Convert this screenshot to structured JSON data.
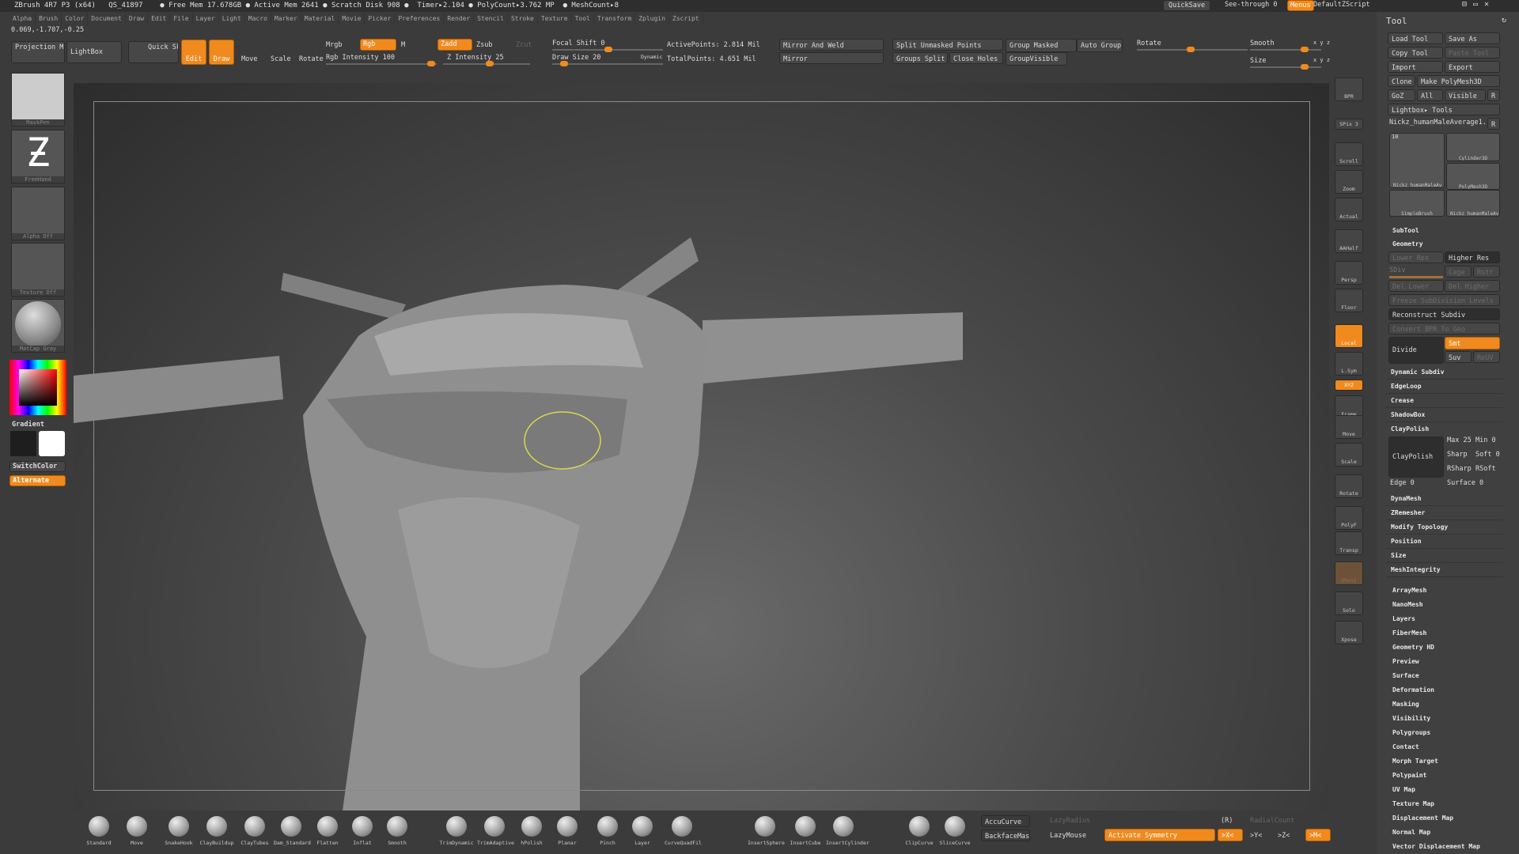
{
  "titlebar": {
    "text": "ZBrush 4R7 P3 (x64)   QS_41897    ● Free Mem 17.678GB ● Active Mem 2641 ● Scratch Disk 908 ●  Timer▸2.104 ● PolyCount▸3.762 MP  ● MeshCount▸8",
    "quicksave": "QuickSave",
    "see_through": "See-through  0",
    "menus": "Menus",
    "default_zscript": "DefaultZScript"
  },
  "menus": [
    "Alpha",
    "Brush",
    "Color",
    "Document",
    "Draw",
    "Edit",
    "File",
    "Layer",
    "Light",
    "Macro",
    "Marker",
    "Material",
    "Movie",
    "Picker",
    "Preferences",
    "Render",
    "Stencil",
    "Stroke",
    "Texture",
    "Tool",
    "Transform",
    "Zplugin",
    "Zscript"
  ],
  "coords": "0.069,-1.707,-0.25",
  "toolbar": {
    "projection_master": "Projection Master",
    "lightbox": "LightBox",
    "quick_sketch": "Quick Sketch",
    "edit": "Edit",
    "draw": "Draw",
    "move": "Move",
    "scale": "Scale",
    "rotate": "Rotate",
    "mrgb": "Mrgb",
    "rgb": "Rgb",
    "m": "M",
    "rgb_intensity": "Rgb Intensity 100",
    "zadd": "Zadd",
    "zsub": "Zsub",
    "zcut": "Zcut",
    "z_intensity": "Z Intensity 25",
    "focal_shift": "Focal Shift 0",
    "draw_size": "Draw Size 20",
    "dynamic": "Dynamic",
    "active_points": "ActivePoints: 2.814 Mil",
    "total_points": "TotalPoints: 4.651 Mil",
    "mirror_and_weld": "Mirror And Weld",
    "mirror": "Mirror",
    "split_unmasked": "Split Unmasked Points",
    "groups_split": "Groups Split",
    "close_holes": "Close Holes",
    "group_masked": "Group Masked",
    "auto_groups": "Auto Groups",
    "group_visible": "GroupVisible",
    "rotate_label": "Rotate",
    "smooth": "Smooth",
    "size": "Size",
    "xyz": "x y z"
  },
  "left_shelf": {
    "brush": "MaskPen",
    "stroke": "FreeHand",
    "alpha": "Alpha Off",
    "texture": "Texture Off",
    "material": "MatCap Gray",
    "gradient": "Gradient",
    "switch_color": "SwitchColor",
    "alternate": "Alternate"
  },
  "right_toolbar": [
    "BPR",
    "SPix 3",
    "Scroll",
    "Zoom",
    "Actual",
    "AAHalf",
    "Persp",
    "Floor",
    "Local",
    "L.Sym",
    "XYZ",
    "Frame",
    "Move",
    "Scale",
    "Rotate",
    "PolyF",
    "Transp",
    "Ghost",
    "Solo",
    "Xpose"
  ],
  "tool_panel": {
    "title": "Tool",
    "load_tool": "Load Tool",
    "save_as": "Save As",
    "copy_tool": "Copy Tool",
    "paste_tool": "Paste Tool",
    "import": "Import",
    "export": "Export",
    "clone": "Clone",
    "make_polymesh": "Make PolyMesh3D",
    "goz": "GoZ",
    "all": "All",
    "visible": "Visible",
    "r": "R",
    "lightbox_tools": "Lightbox▸ Tools",
    "current_tool": "Nickz_humanMaleAverage1.",
    "thumbs": [
      "Nickz_humanMaleAv",
      "Cylinder3D",
      "PolyMesh3D",
      "SimpleBrush",
      "Nickz_humanMaleAv"
    ],
    "thumb_count": "10",
    "subtool": "SubTool",
    "geometry": "Geometry",
    "lower_res": "Lower Res",
    "higher_res": "Higher Res",
    "sdiv": "SDiv",
    "cage": "Cage",
    "rstr": "Rstr",
    "del_lower": "Del Lower",
    "del_higher": "Del Higher",
    "freeze": "Freeze SubDivision Levels",
    "reconstruct": "Reconstruct Subdiv",
    "convert_bpr": "Convert BPR To Geo",
    "divide": "Divide",
    "smt": "Smt",
    "suv": "Suv",
    "reuv": "ReUV",
    "geo_items": [
      "Dynamic Subdiv",
      "EdgeLoop",
      "Crease",
      "ShadowBox",
      "ClayPolish"
    ],
    "claypolish_btn": "ClayPolish",
    "max": "Max 25",
    "min": "Min 0",
    "sharp": "Sharp",
    "soft": "Soft 0",
    "rsharp": "RSharp",
    "rsoft": "RSoft",
    "edge": "Edge 0",
    "surface": "Surface 0",
    "geo_items2": [
      "DynaMesh",
      "ZRemesher",
      "Modify Topology",
      "Position",
      "Size",
      "MeshIntegrity"
    ],
    "sections": [
      "ArrayMesh",
      "NanoMesh",
      "Layers",
      "FiberMesh",
      "Geometry HD",
      "Preview",
      "Surface",
      "Deformation",
      "Masking",
      "Visibility",
      "Polygroups",
      "Contact",
      "Morph Target",
      "Polypaint",
      "UV Map",
      "Texture Map",
      "Displacement Map",
      "Normal Map",
      "Vector Displacement Map"
    ]
  },
  "brushes": [
    "Standard",
    "Move",
    "SnakeHook",
    "ClayBuildup",
    "ClayTubes",
    "Dam_Standard",
    "Flatten",
    "Inflat",
    "Smooth",
    "TrimDynamic",
    "TrimAdaptive",
    "hPolish",
    "Planar",
    "Pinch",
    "Layer",
    "CurveQuadFil",
    "InsertSphere",
    "InsertCube",
    "InsertCylinder",
    "ClipCurve",
    "SliceCurve"
  ],
  "bottom": {
    "accucurve": "AccuCurve",
    "backfacemask": "BackfaceMask",
    "lazyradius": "LazyRadius",
    "lazymouse": "LazyMouse",
    "activate_symmetry": "Activate Symmetry",
    "r": "(R)",
    "radialcount": "RadialCount",
    "x": ">X<",
    "y": ">Y<",
    "z": ">Z<",
    "m": ">M<"
  },
  "accent": "#f08a1e"
}
